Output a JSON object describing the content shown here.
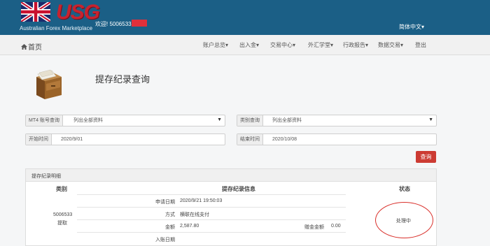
{
  "brand": {
    "logo_text": "USG",
    "tagline": "Australian Forex Marketplace",
    "welcome": "欢迎! 5006533"
  },
  "header": {
    "language": "简体中文"
  },
  "nav": {
    "home": "首页",
    "items": [
      "账户总览",
      "出入金",
      "交易中心",
      "外汇学堂",
      "行政报告",
      "数据交易",
      "登出"
    ]
  },
  "page": {
    "title": "提存纪录查询"
  },
  "filters": {
    "account_label": "MT4 账号查询",
    "account_value": "列出全部资料",
    "category_label": "类别查询",
    "category_value": "列出全部资料",
    "start_label": "开始时间",
    "start_value": "2020/9/01",
    "end_label": "结束时间",
    "end_value": "2020/10/08",
    "query_button": "查询"
  },
  "records": {
    "panel_title": "提存纪录明细",
    "columns": [
      "类别",
      "提存纪录信息",
      "状态"
    ],
    "row": {
      "account": "5006533",
      "type": "提取",
      "apply_date_label": "申请日期",
      "apply_date_value": "2020/9/21 19:50:03",
      "method_label": "方式",
      "method_value": "横联在线支付",
      "amount_label": "金额",
      "amount_value": "2,587.80",
      "fee_label": "赠金金额",
      "fee_value": "0.00",
      "deposit_date_label": "入账日期",
      "deposit_date_value": "",
      "status": "处理中"
    }
  },
  "colors": {
    "topbar": "#1b5f86",
    "accent_red": "#cc3b33",
    "annotation": "#d9302b"
  }
}
